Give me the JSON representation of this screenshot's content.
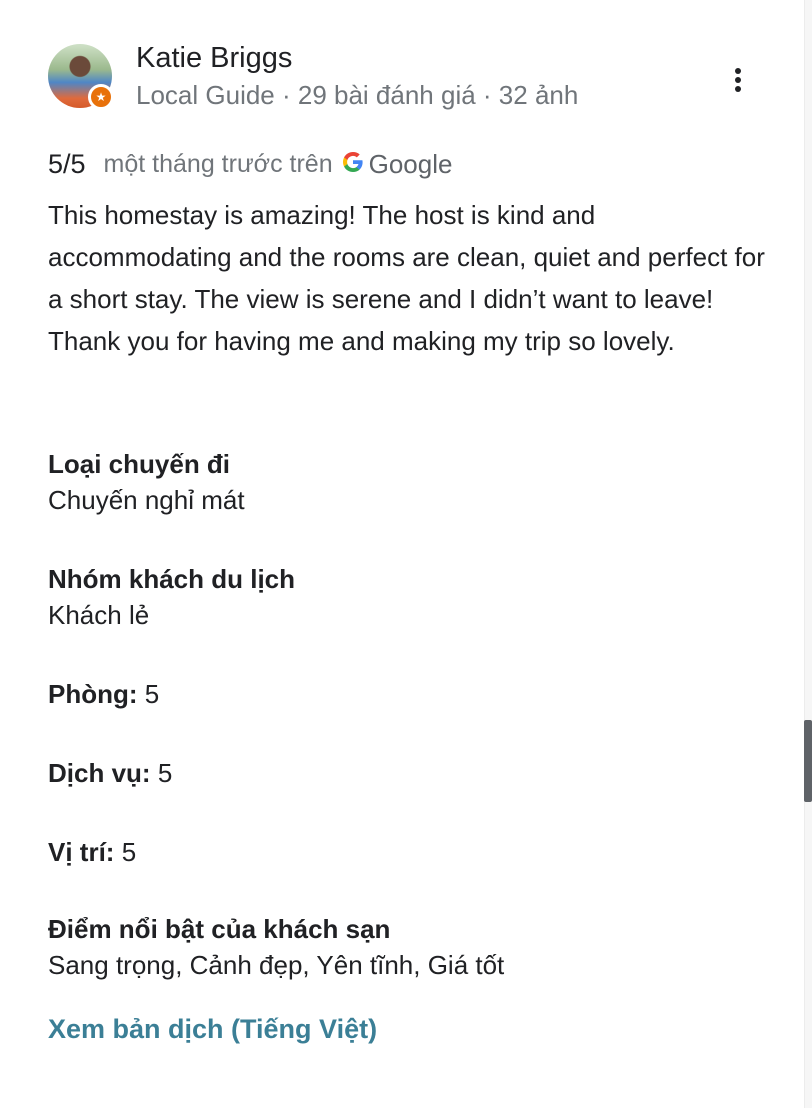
{
  "author": {
    "name": "Katie Briggs",
    "meta": "Local Guide · 29 bài đánh giá · 32 ảnh",
    "badge_icon": "local-guide-star-icon"
  },
  "menu_icon": "more-vert-icon",
  "review": {
    "rating": "5/5",
    "time": "một tháng trước trên",
    "source": "Google",
    "source_icon": "google-g-icon",
    "text": "This homestay is amazing! The host is kind and accommodating and the rooms are clean, quiet and perfect for a short stay. The view is serene and I didn’t want to leave! Thank you for having me and making my trip so lovely."
  },
  "details": {
    "trip_type": {
      "label": "Loại chuyến đi",
      "value": "Chuyến nghỉ mát"
    },
    "travel_group": {
      "label": "Nhóm khách du lịch",
      "value": "Khách lẻ"
    },
    "rooms": {
      "label": "Phòng:",
      "value": "5"
    },
    "service": {
      "label": "Dịch vụ:",
      "value": "5"
    },
    "location": {
      "label": "Vị trí:",
      "value": "5"
    },
    "highlights": {
      "label": "Điểm nổi bật của khách sạn",
      "value": "Sang trọng, Cảnh đẹp, Yên tĩnh, Giá tốt"
    }
  },
  "translate_link": "Xem bản dịch (Tiếng Việt)",
  "colors": {
    "link": "#3b7f96",
    "muted": "#70757a",
    "badge": "#e8710a"
  }
}
